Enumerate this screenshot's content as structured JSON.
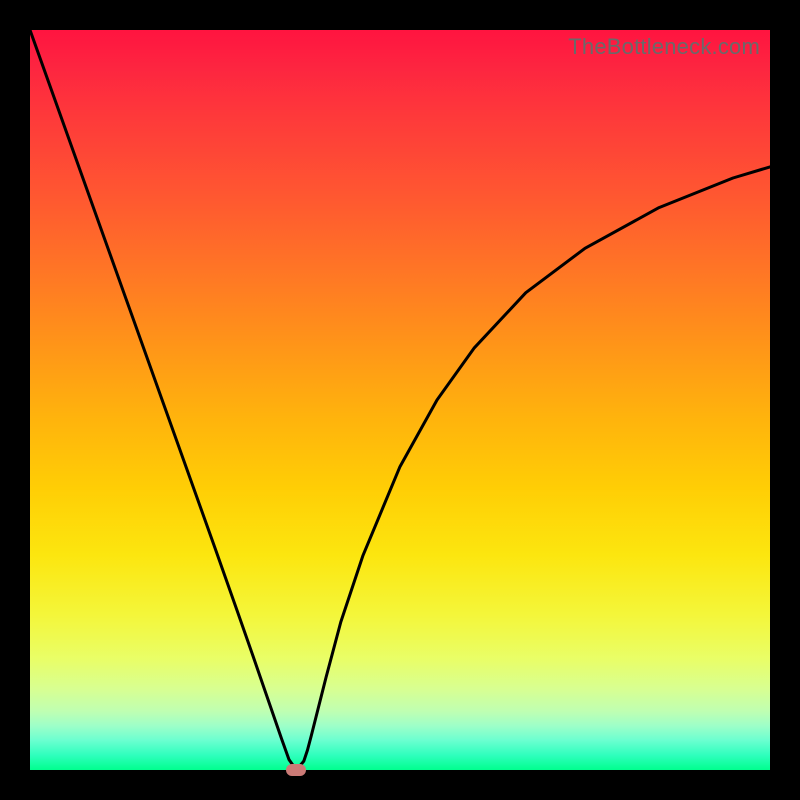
{
  "watermark": "TheBottleneck.com",
  "chart_data": {
    "type": "line",
    "title": "",
    "xlabel": "",
    "ylabel": "",
    "xlim": [
      0,
      100
    ],
    "ylim": [
      0,
      100
    ],
    "series": [
      {
        "name": "bottleneck-curve",
        "x": [
          0,
          5,
          10,
          15,
          20,
          25,
          28,
          30,
          32,
          34,
          35,
          36,
          37,
          37.5,
          38,
          40,
          42,
          45,
          50,
          55,
          60,
          67,
          75,
          85,
          95,
          100
        ],
        "y": [
          100,
          86,
          72,
          58,
          44,
          30,
          21.5,
          15.8,
          10,
          4.2,
          1.4,
          0,
          1.2,
          2.7,
          4.6,
          12.5,
          20,
          29,
          41,
          50,
          57,
          64.5,
          70.5,
          76,
          80,
          81.5
        ]
      }
    ],
    "annotations": [
      {
        "name": "minimum-marker",
        "x": 36,
        "y": 0,
        "color": "#cb7a76"
      }
    ],
    "grid": false,
    "legend": false
  }
}
